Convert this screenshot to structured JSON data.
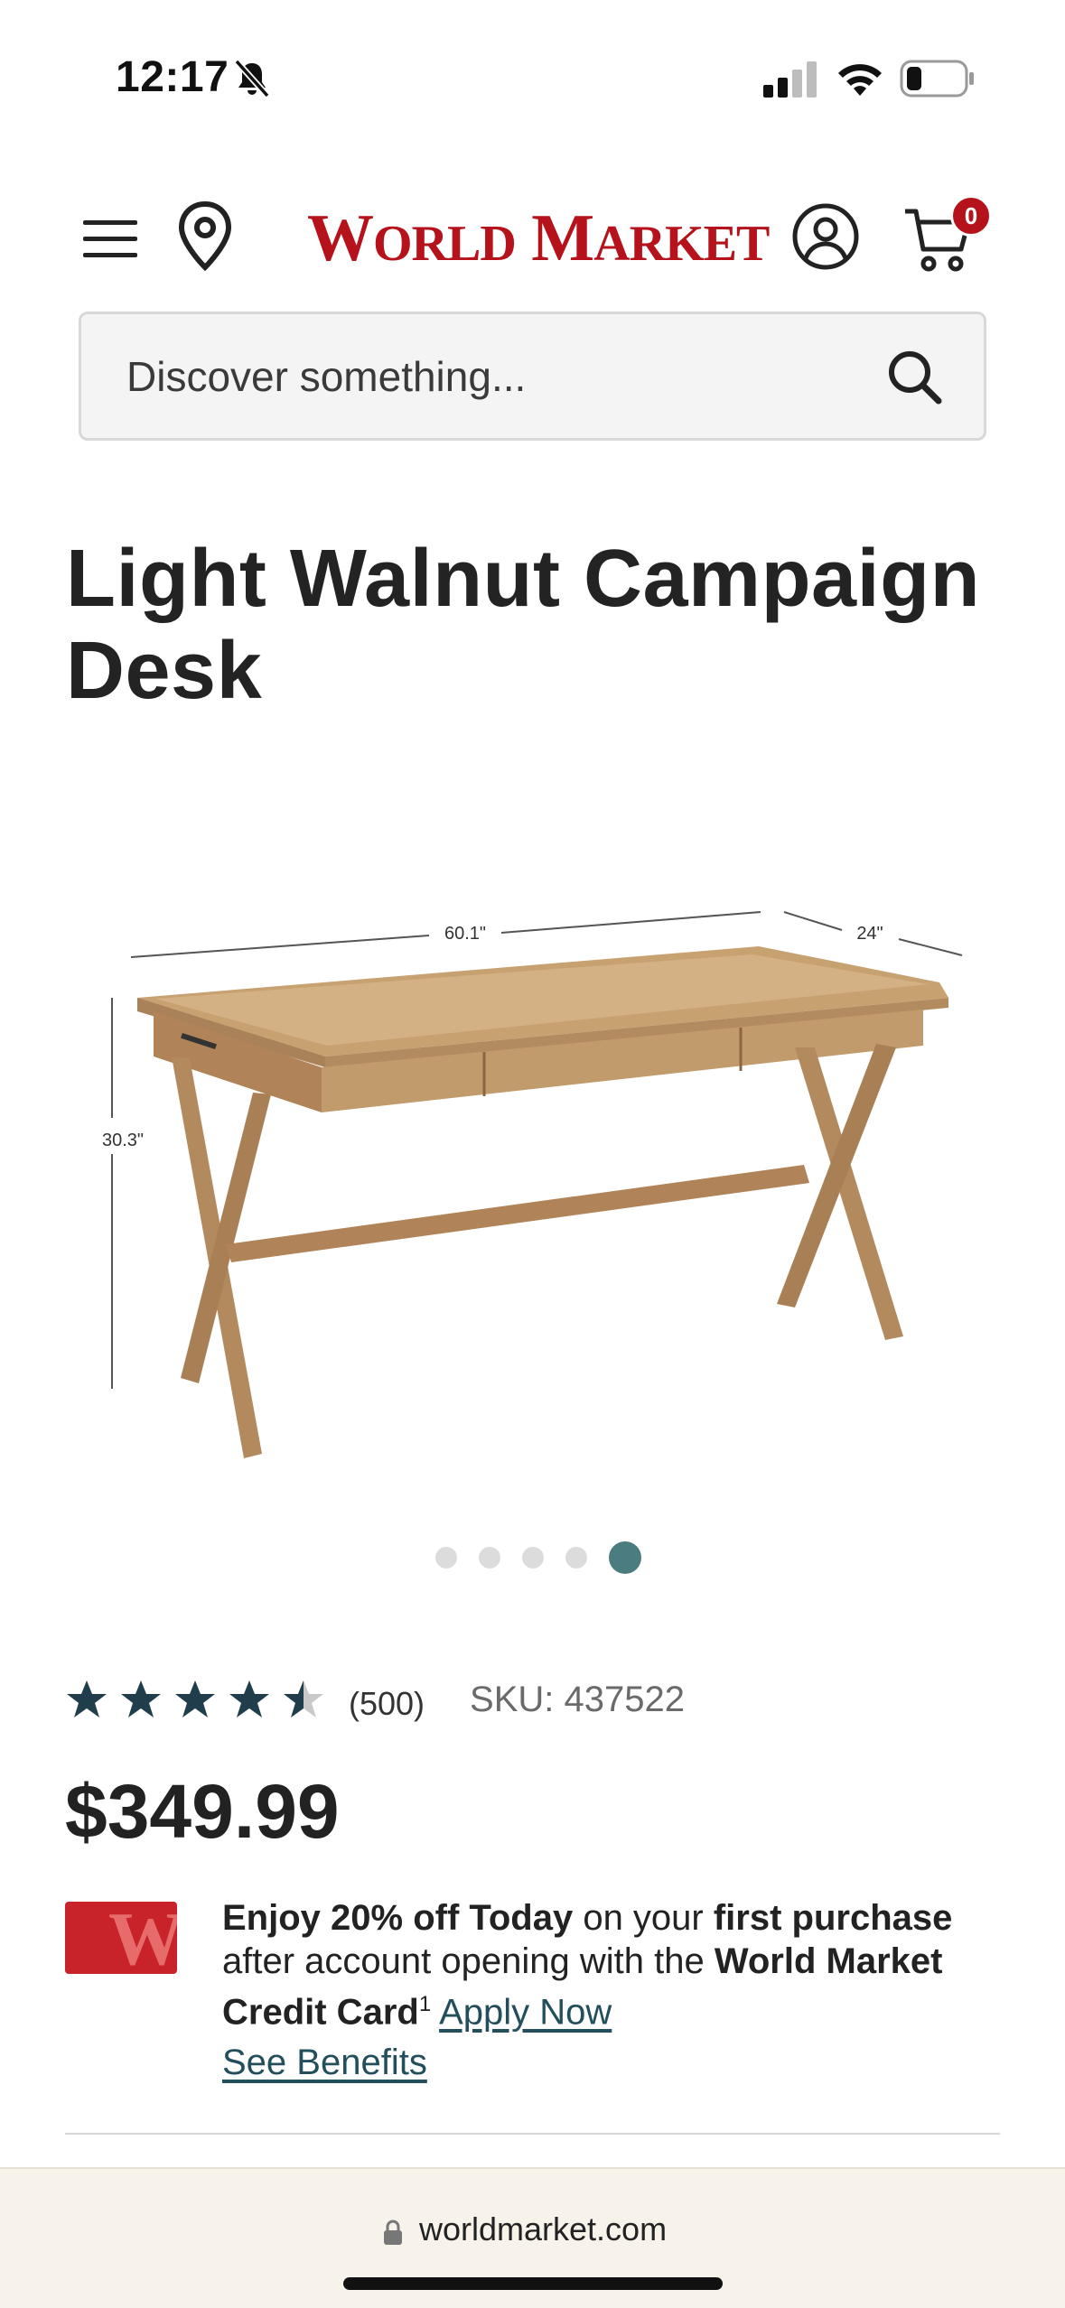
{
  "status_bar": {
    "time": "12:17"
  },
  "header": {
    "logo_text": "WORLD MARKET",
    "cart_count": "0"
  },
  "search": {
    "placeholder": "Discover something..."
  },
  "product": {
    "title": "Light Walnut Campaign Desk",
    "dimensions": {
      "width": "60.1\"",
      "depth": "24\"",
      "height": "30.3\""
    },
    "image_count": 5,
    "active_image_index": 4,
    "rating": 4.5,
    "rating_count": "(500)",
    "sku": "SKU: 437522",
    "price": "$349.99"
  },
  "promo": {
    "part1_bold": "Enjoy 20% off Today",
    "part2": " on your ",
    "part3_bold": "first purchase",
    "part4": " after account opening with the ",
    "part5_bold": "World Market Credit Card",
    "footnote": "1",
    "apply_link": "Apply Now",
    "benefits_link": "See Benefits"
  },
  "browser": {
    "url": "worldmarket.com"
  },
  "colors": {
    "brand_red": "#b5121b",
    "accent_teal": "#4a7c80",
    "star": "#1f3d4a",
    "link": "#234e5b"
  }
}
